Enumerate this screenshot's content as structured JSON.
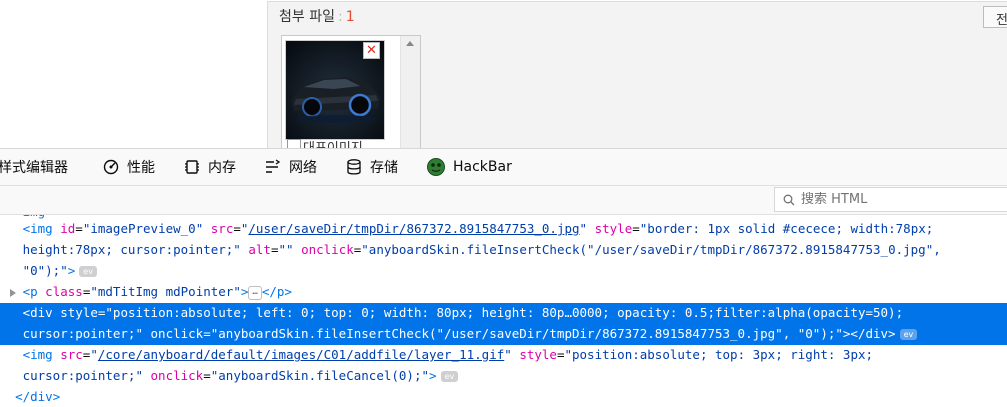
{
  "webpage": {
    "attach_label": "첨부 파일",
    "attach_sep": ":",
    "attach_count": "1",
    "side_button": "전",
    "remove_icon": "✕",
    "representative_label": "대표이미지"
  },
  "devtools": {
    "tabs": [
      {
        "label": "样式编辑器",
        "icon": "style-editor-icon"
      },
      {
        "label": "性能",
        "icon": "performance-icon"
      },
      {
        "label": "内存",
        "icon": "memory-icon"
      },
      {
        "label": "网络",
        "icon": "network-icon"
      },
      {
        "label": "存储",
        "icon": "storage-icon"
      },
      {
        "label": "HackBar",
        "icon": "hackbar-icon"
      }
    ],
    "search_placeholder": "搜索 HTML",
    "markup": {
      "img1": {
        "open": "<img",
        "a1": "id",
        "v1": "\"imagePreview_0\"",
        "a2": "src",
        "v2": "/user/saveDir/tmpDir/867372.8915847753_0.jpg",
        "a3": "style",
        "v3": "\"border: 1px solid #cecece; width:78px;",
        "v3b": "height:78px; cursor:pointer;\"",
        "a4": "alt",
        "v4": "\"\"",
        "a5": "onclick",
        "v5": "\"anyboardSkin.fileInsertCheck(\"/user/saveDir/tmpDir/867372.8915847753_0.jpg\",",
        "v5b": "\"0\");\"",
        "close": ">"
      },
      "p1": {
        "open": "<p",
        "a1": "class",
        "v1": "\"mdTitImg mdPointer\"",
        "close": ">",
        "ellipsis": "…",
        "end": "</p>"
      },
      "div1": {
        "open": "<div",
        "a1": "style",
        "v1": "\"position:absolute; left: 0; top: 0; width: 80px; height: 80p…0000; opacity: 0.5;filter:alpha(opacity=50);",
        "v1b": "cursor:pointer;\"",
        "a2": "onclick",
        "v2": "\"anyboardSkin.fileInsertCheck(\"/user/saveDir/tmpDir/867372.8915847753_0.jpg\", \"0\");\"",
        "close": "></div>"
      },
      "img2": {
        "open": "<img",
        "a1": "src",
        "v1": "/core/anyboard/default/images/C01/addfile/layer_11.gif",
        "a2": "style",
        "v2": "\"position:absolute; top: 3px; right: 3px;",
        "v2b": "cursor:pointer;\"",
        "a3": "onclick",
        "v3": "\"anyboardSkin.fileCancel(0);\"",
        "close": ">"
      },
      "div_close": "</div>",
      "event_badge": "ev"
    },
    "colors": {
      "selection": "#0074e8",
      "tag": "#0074e8",
      "attr_name": "#dd00a9",
      "attr_value": "#003eaa"
    }
  }
}
